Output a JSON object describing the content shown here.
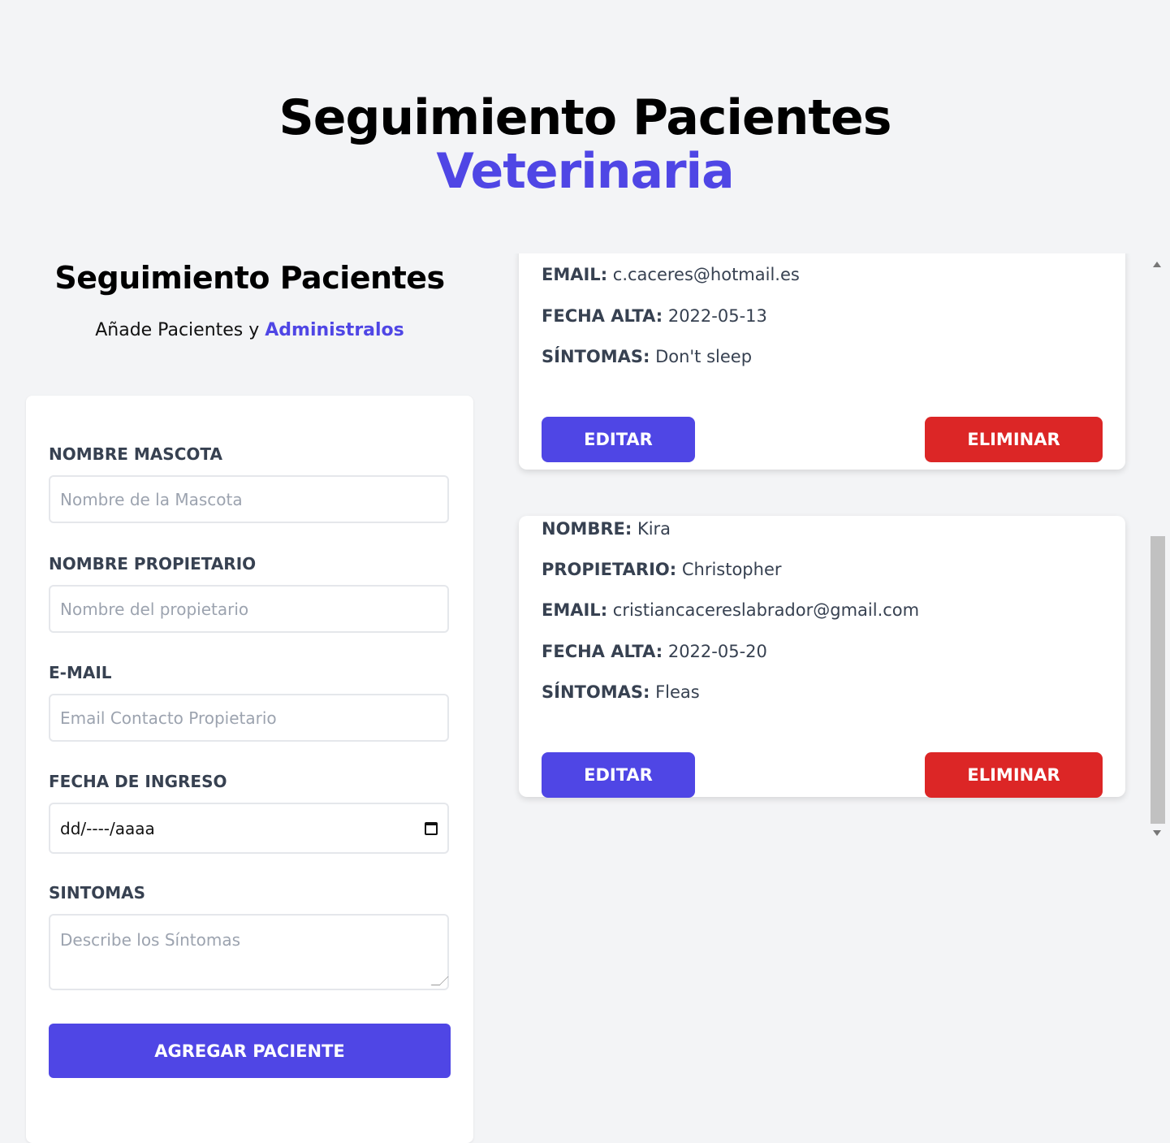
{
  "header": {
    "title_line1": "Seguimiento Pacientes",
    "title_line2": "Veterinaria"
  },
  "form_section": {
    "title": "Seguimiento Pacientes",
    "subtitle_prefix": "Añade Pacientes y ",
    "subtitle_accent": "Administralos",
    "fields": {
      "pet_name": {
        "label": "Nombre Mascota",
        "placeholder": "Nombre de la Mascota"
      },
      "owner_name": {
        "label": "Nombre Propietario",
        "placeholder": "Nombre del propietario"
      },
      "email": {
        "label": "E-mail",
        "placeholder": "Email Contacto Propietario"
      },
      "date": {
        "label": "Fecha de Ingreso",
        "value": "dd/----/aaaa"
      },
      "symptoms": {
        "label": "Sintomas",
        "placeholder": "Describe los Síntomas"
      }
    },
    "submit_label": "Agregar Paciente"
  },
  "patients": [
    {
      "email_label": "Email:",
      "email": "c.caceres@hotmail.es",
      "date_label": "Fecha Alta:",
      "date": "2022-05-13",
      "symptoms_label": "Síntomas:",
      "symptoms": "Don't sleep",
      "edit_label": "Editar",
      "delete_label": "Eliminar"
    },
    {
      "name_label": "Nombre:",
      "name": "Kira",
      "owner_label": "Propietario:",
      "owner": "Christopher",
      "email_label": "Email:",
      "email": "cristiancacereslabrador@gmail.com",
      "date_label": "Fecha Alta:",
      "date": "2022-05-20",
      "symptoms_label": "Síntomas:",
      "symptoms": "Fleas",
      "edit_label": "Editar",
      "delete_label": "Eliminar"
    }
  ],
  "colors": {
    "accent": "#4f46e5",
    "danger": "#dc2626",
    "background": "#f3f4f6"
  }
}
